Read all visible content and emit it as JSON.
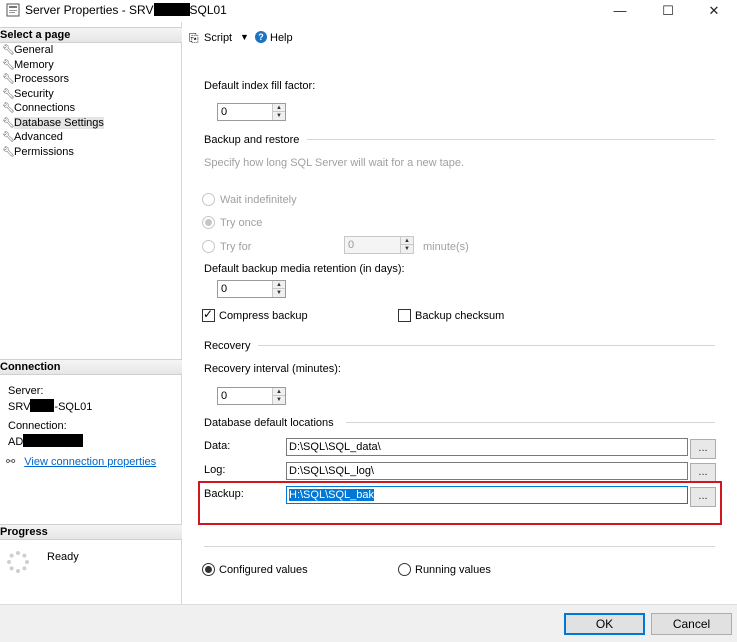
{
  "window": {
    "title_prefix": "Server Properties - SRV",
    "title_suffix": "SQL01",
    "minimize": "—",
    "maximize": "☐",
    "close": "✕"
  },
  "left": {
    "select_page_header": "Select a page",
    "pages": [
      {
        "label": "General"
      },
      {
        "label": "Memory"
      },
      {
        "label": "Processors"
      },
      {
        "label": "Security"
      },
      {
        "label": "Connections"
      },
      {
        "label": "Database Settings"
      },
      {
        "label": "Advanced"
      },
      {
        "label": "Permissions"
      }
    ],
    "connection_header": "Connection",
    "server_label": "Server:",
    "server_prefix": "SRV",
    "server_suffix": "-SQL01",
    "connection_label": "Connection:",
    "connection_prefix": "AD",
    "view_connection_link": "View connection properties",
    "progress_header": "Progress",
    "progress_status": "Ready"
  },
  "toolbar": {
    "script_label": "Script",
    "help_label": "Help"
  },
  "settings": {
    "fill_factor_label": "Default index fill factor:",
    "fill_factor_value": "0",
    "backup_restore_group": "Backup and restore",
    "tape_hint": "Specify how long SQL Server will wait for a new tape.",
    "wait_indefinitely": "Wait indefinitely",
    "try_once": "Try once",
    "try_for": "Try for",
    "try_for_value": "0",
    "minutes_unit": "minute(s)",
    "retention_label": "Default backup media retention (in days):",
    "retention_value": "0",
    "compress_backup": "Compress backup",
    "backup_checksum": "Backup checksum",
    "recovery_group": "Recovery",
    "recovery_interval_label": "Recovery interval (minutes):",
    "recovery_interval_value": "0",
    "default_locations_group": "Database default locations",
    "data_label": "Data:",
    "data_path": "D:\\SQL\\SQL_data\\",
    "log_label": "Log:",
    "log_path": "D:\\SQL\\SQL_log\\",
    "backup_label": "Backup:",
    "backup_path": "H:\\SQL\\SQL_bak",
    "browse": "...",
    "configured_values": "Configured values",
    "running_values": "Running values"
  },
  "footer": {
    "ok": "OK",
    "cancel": "Cancel"
  },
  "colors": {
    "annotation_red": "#d0161e",
    "link_blue": "#0066cc",
    "selection_blue": "#0078d7"
  },
  "state": {
    "selected_page": "Database Settings",
    "compress_backup_checked": true,
    "backup_checksum_checked": false,
    "selected_tape_option": "Try once",
    "selected_values_mode": "Configured values"
  }
}
